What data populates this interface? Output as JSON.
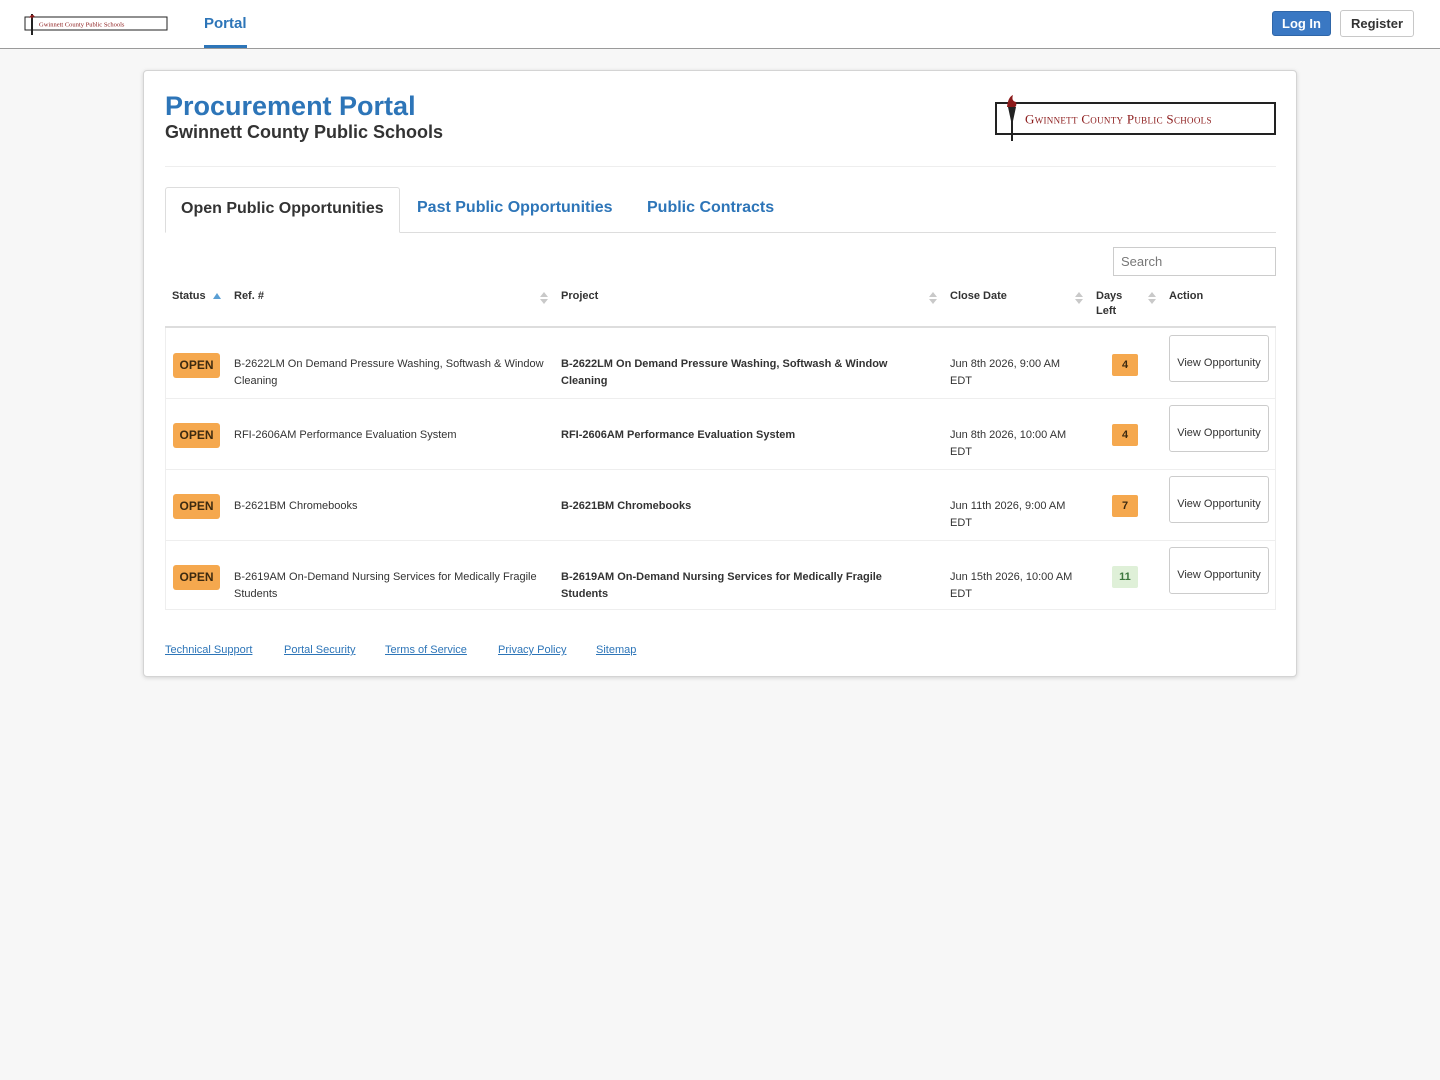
{
  "nav": {
    "logo_text": "Gwinnett County Public Schools",
    "portal_label": "Portal",
    "login_label": "Log In",
    "register_label": "Register"
  },
  "header": {
    "title": "Procurement Portal",
    "subtitle": "Gwinnett County Public Schools",
    "logo_text": "Gwinnett County Public Schools"
  },
  "colors": {
    "brand": "#2d75b8",
    "badge_open": "#f5a84e",
    "days_ok": "#dff0d8",
    "logo_maroon": "#8b1a1a"
  },
  "tabs": [
    {
      "label": "Open Public Opportunities",
      "active": true
    },
    {
      "label": "Past Public Opportunities",
      "active": false
    },
    {
      "label": "Public Contracts",
      "active": false
    }
  ],
  "search": {
    "placeholder": "Search"
  },
  "table": {
    "columns": [
      "Status",
      "Ref. #",
      "Project",
      "Close Date",
      "Days Left",
      "Action"
    ],
    "rows": [
      {
        "status": "OPEN",
        "ref": "B-2622LM On Demand Pressure Washing, Softwash & Window Cleaning",
        "project": "B-2622LM On Demand Pressure Washing, Softwash & Window Cleaning",
        "close_date": "Jun 8th 2026, 9:00 AM EDT",
        "days_left": "4",
        "action": "View Opportunity"
      },
      {
        "status": "OPEN",
        "ref": "RFI-2606AM Performance Evaluation System",
        "project": "RFI-2606AM Performance Evaluation System",
        "close_date": "Jun 8th 2026, 10:00 AM EDT",
        "days_left": "4",
        "action": "View Opportunity"
      },
      {
        "status": "OPEN",
        "ref": "B-2621BM Chromebooks",
        "project": "B-2621BM Chromebooks",
        "close_date": "Jun 11th 2026, 9:00 AM EDT",
        "days_left": "7",
        "action": "View Opportunity"
      },
      {
        "status": "OPEN",
        "ref": "B-2619AM On-Demand Nursing Services for Medically Fragile Students",
        "project": "B-2619AM On-Demand Nursing Services for Medically Fragile Students",
        "close_date": "Jun 15th 2026, 10:00 AM EDT",
        "days_left": "11",
        "action": "View Opportunity"
      }
    ]
  },
  "footer": {
    "links": [
      "Technical Support",
      "Portal Security",
      "Terms of Service",
      "Privacy Policy",
      "Sitemap"
    ]
  }
}
